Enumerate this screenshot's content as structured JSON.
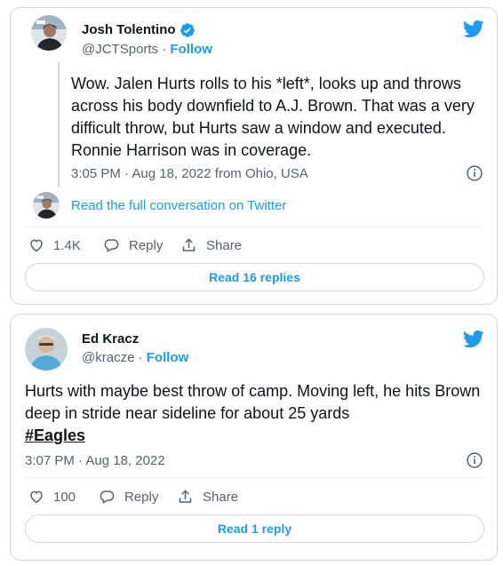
{
  "tweets": [
    {
      "author_name": "Josh Tolentino",
      "handle": "@JCTSports",
      "separator": "·",
      "follow_label": "Follow",
      "verified": true,
      "text": "Wow. Jalen Hurts rolls to his *left*, looks up and throws across his body downfield to A.J. Brown. That was a very difficult throw, but Hurts saw a window and executed. Ronnie Harrison was in coverage.",
      "timestamp": "3:05 PM · Aug 18, 2022 from Ohio, USA",
      "conversation_link": "Read the full conversation on Twitter",
      "likes": "1.4K",
      "reply_label": "Reply",
      "share_label": "Share",
      "read_replies": "Read 16 replies"
    },
    {
      "author_name": "Ed Kracz",
      "handle": "@kracze",
      "separator": "·",
      "follow_label": "Follow",
      "verified": false,
      "text_main": "Hurts with maybe best throw of camp. Moving left, he hits Brown deep in stride near sideline for about 25 yards",
      "hashtag": "#Eagles",
      "timestamp": "3:07 PM · Aug 18, 2022",
      "likes": "100",
      "reply_label": "Reply",
      "share_label": "Share",
      "read_replies": "Read 1 reply"
    }
  ],
  "colors": {
    "twitter_blue": "#1d9bf0",
    "text_primary": "#0f1419",
    "text_secondary": "#536471",
    "border": "#cfd9de"
  }
}
